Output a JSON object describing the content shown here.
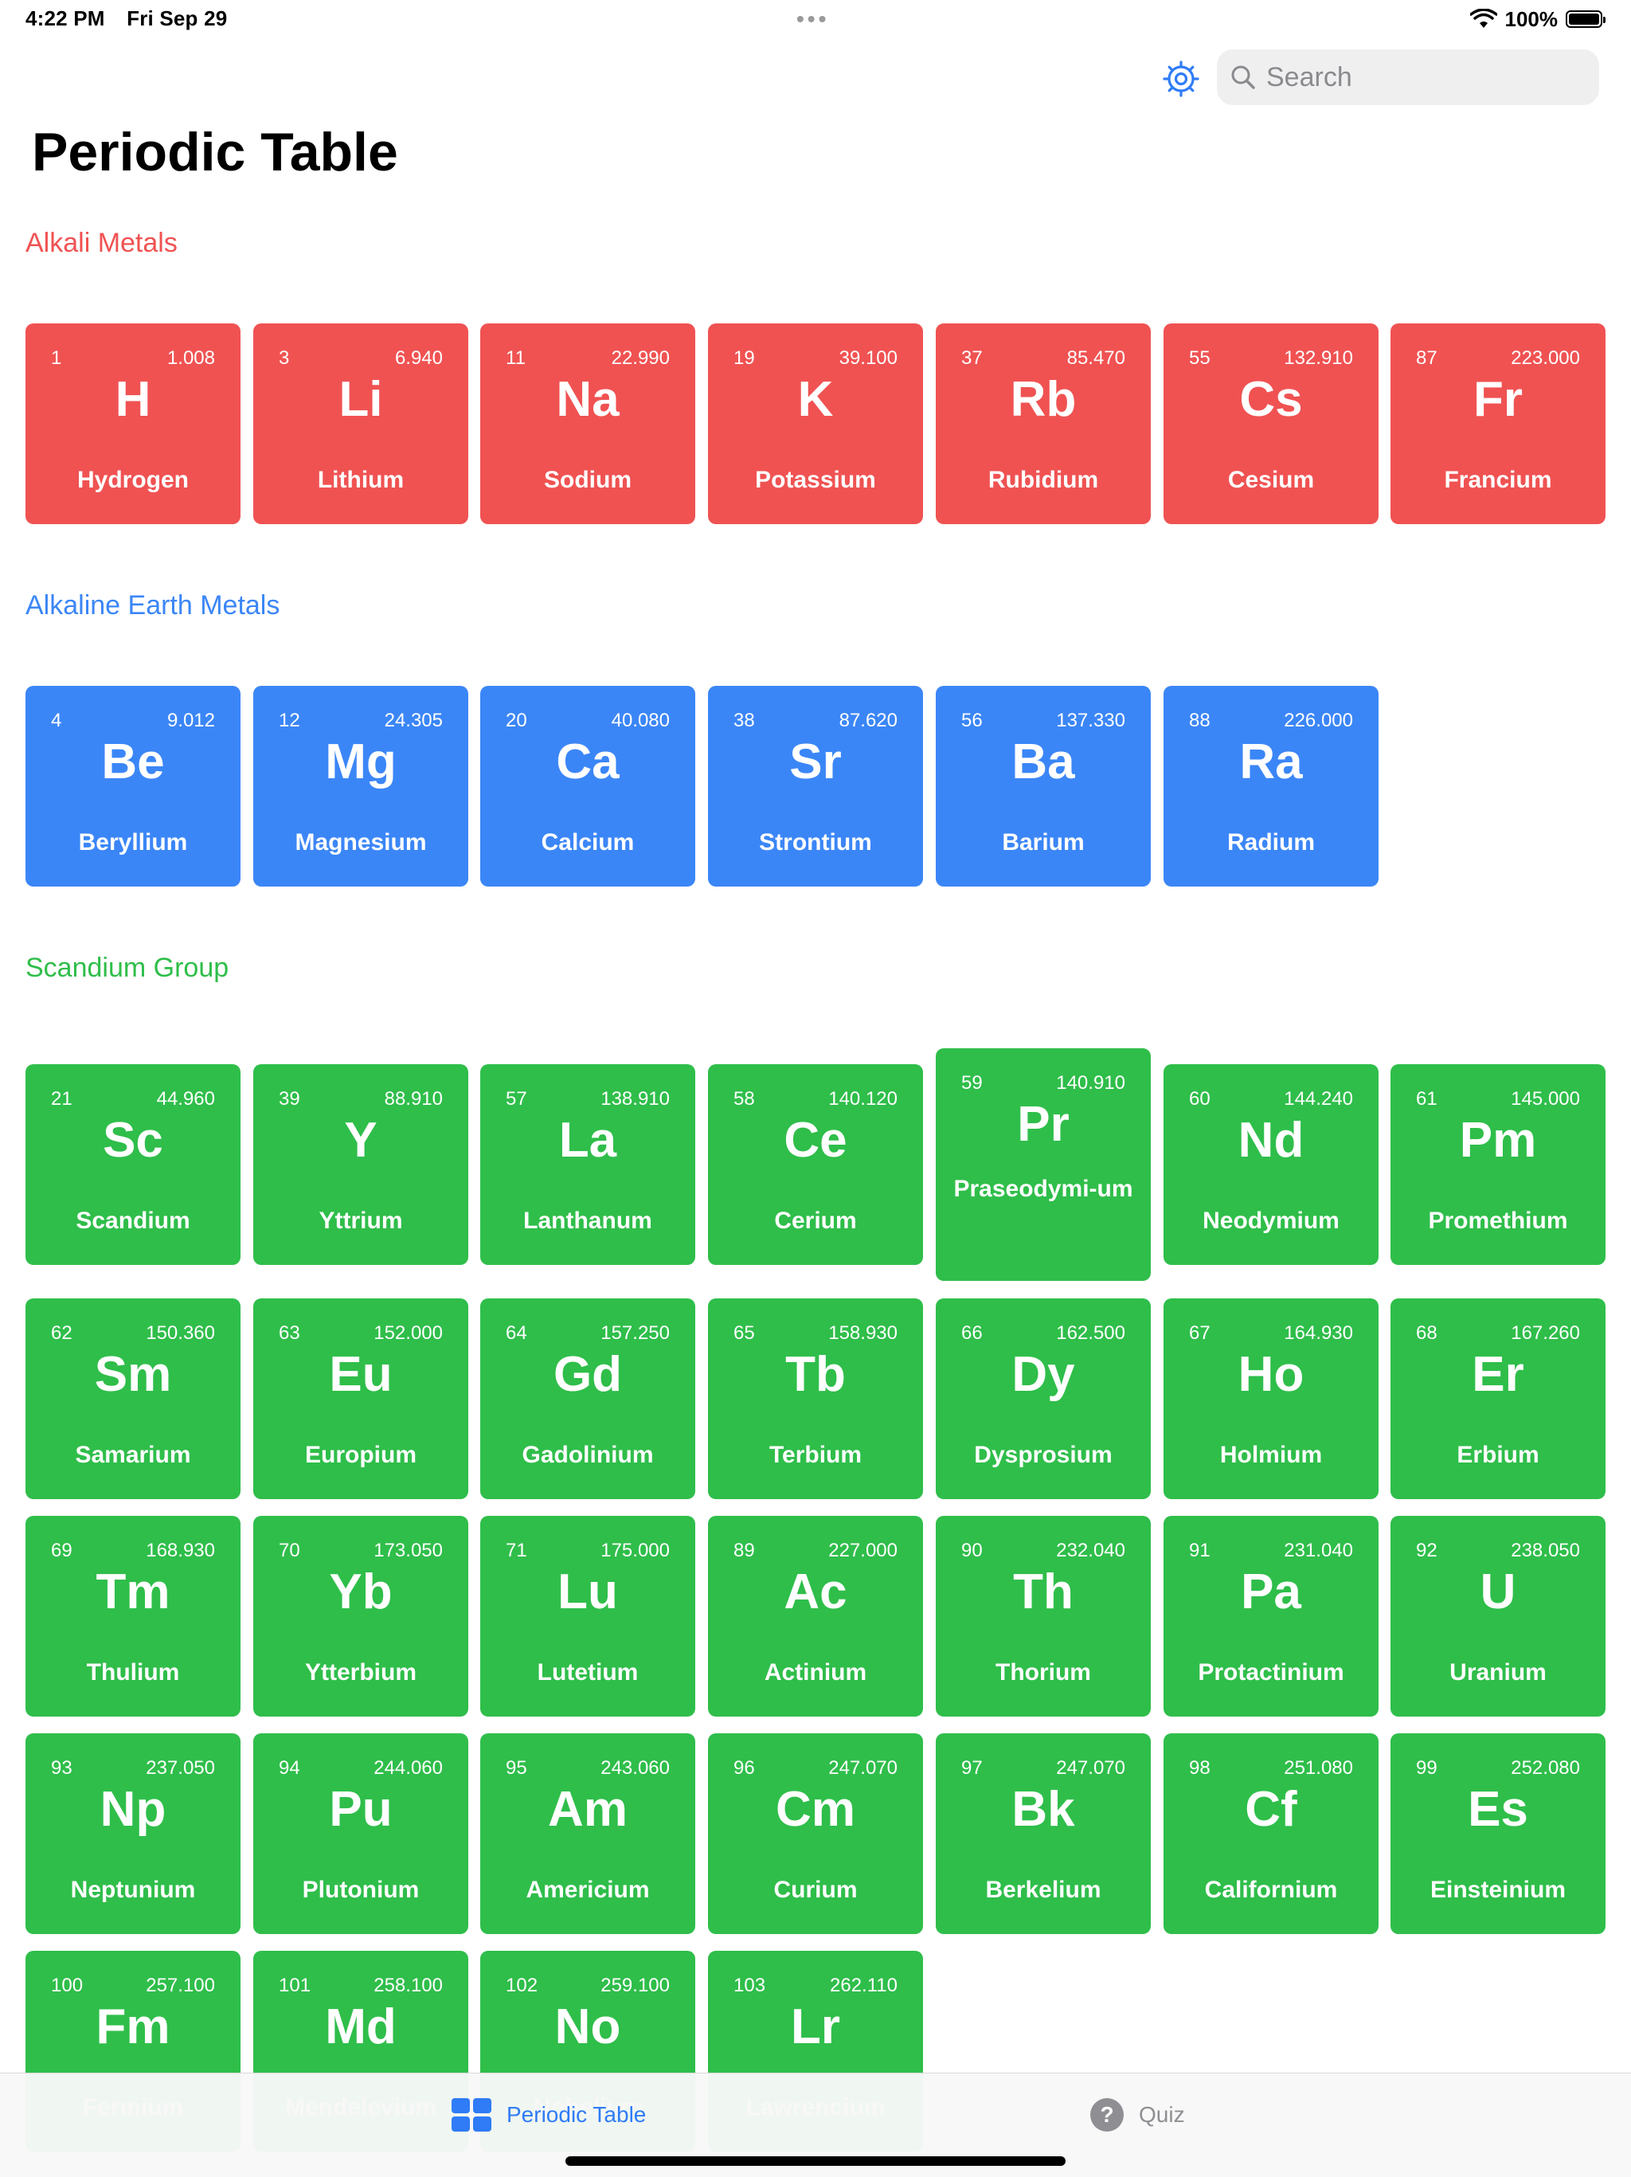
{
  "status_bar": {
    "time": "4:22 PM",
    "date": "Fri Sep 29",
    "dots": "•••",
    "battery": "100%"
  },
  "search": {
    "placeholder": "Search"
  },
  "page_title": "Periodic Table",
  "colors": {
    "alkali": "#f05252",
    "alkaline": "#3b86f7",
    "scandium": "#2fbe4a",
    "accent": "#2f7cf6"
  },
  "sections": {
    "alkali": {
      "title": "Alkali Metals",
      "elements": [
        {
          "number": "1",
          "mass": "1.008",
          "symbol": "H",
          "name": "Hydrogen"
        },
        {
          "number": "3",
          "mass": "6.940",
          "symbol": "Li",
          "name": "Lithium"
        },
        {
          "number": "11",
          "mass": "22.990",
          "symbol": "Na",
          "name": "Sodium"
        },
        {
          "number": "19",
          "mass": "39.100",
          "symbol": "K",
          "name": "Potassium"
        },
        {
          "number": "37",
          "mass": "85.470",
          "symbol": "Rb",
          "name": "Rubidium"
        },
        {
          "number": "55",
          "mass": "132.910",
          "symbol": "Cs",
          "name": "Cesium"
        },
        {
          "number": "87",
          "mass": "223.000",
          "symbol": "Fr",
          "name": "Francium"
        }
      ]
    },
    "alkaline": {
      "title": "Alkaline Earth Metals",
      "elements": [
        {
          "number": "4",
          "mass": "9.012",
          "symbol": "Be",
          "name": "Beryllium"
        },
        {
          "number": "12",
          "mass": "24.305",
          "symbol": "Mg",
          "name": "Magnesium"
        },
        {
          "number": "20",
          "mass": "40.080",
          "symbol": "Ca",
          "name": "Calcium"
        },
        {
          "number": "38",
          "mass": "87.620",
          "symbol": "Sr",
          "name": "Strontium"
        },
        {
          "number": "56",
          "mass": "137.330",
          "symbol": "Ba",
          "name": "Barium"
        },
        {
          "number": "88",
          "mass": "226.000",
          "symbol": "Ra",
          "name": "Radium"
        }
      ]
    },
    "scandium": {
      "title": "Scandium Group",
      "elements": [
        {
          "number": "21",
          "mass": "44.960",
          "symbol": "Sc",
          "name": "Scandium"
        },
        {
          "number": "39",
          "mass": "88.910",
          "symbol": "Y",
          "name": "Yttrium"
        },
        {
          "number": "57",
          "mass": "138.910",
          "symbol": "La",
          "name": "Lanthanum"
        },
        {
          "number": "58",
          "mass": "140.120",
          "symbol": "Ce",
          "name": "Cerium"
        },
        {
          "number": "59",
          "mass": "140.910",
          "symbol": "Pr",
          "name": "Praseodymi-um"
        },
        {
          "number": "60",
          "mass": "144.240",
          "symbol": "Nd",
          "name": "Neodymium"
        },
        {
          "number": "61",
          "mass": "145.000",
          "symbol": "Pm",
          "name": "Promethium"
        },
        {
          "number": "62",
          "mass": "150.360",
          "symbol": "Sm",
          "name": "Samarium"
        },
        {
          "number": "63",
          "mass": "152.000",
          "symbol": "Eu",
          "name": "Europium"
        },
        {
          "number": "64",
          "mass": "157.250",
          "symbol": "Gd",
          "name": "Gadolinium"
        },
        {
          "number": "65",
          "mass": "158.930",
          "symbol": "Tb",
          "name": "Terbium"
        },
        {
          "number": "66",
          "mass": "162.500",
          "symbol": "Dy",
          "name": "Dysprosium"
        },
        {
          "number": "67",
          "mass": "164.930",
          "symbol": "Ho",
          "name": "Holmium"
        },
        {
          "number": "68",
          "mass": "167.260",
          "symbol": "Er",
          "name": "Erbium"
        },
        {
          "number": "69",
          "mass": "168.930",
          "symbol": "Tm",
          "name": "Thulium"
        },
        {
          "number": "70",
          "mass": "173.050",
          "symbol": "Yb",
          "name": "Ytterbium"
        },
        {
          "number": "71",
          "mass": "175.000",
          "symbol": "Lu",
          "name": "Lutetium"
        },
        {
          "number": "89",
          "mass": "227.000",
          "symbol": "Ac",
          "name": "Actinium"
        },
        {
          "number": "90",
          "mass": "232.040",
          "symbol": "Th",
          "name": "Thorium"
        },
        {
          "number": "91",
          "mass": "231.040",
          "symbol": "Pa",
          "name": "Protactinium"
        },
        {
          "number": "92",
          "mass": "238.050",
          "symbol": "U",
          "name": "Uranium"
        },
        {
          "number": "93",
          "mass": "237.050",
          "symbol": "Np",
          "name": "Neptunium"
        },
        {
          "number": "94",
          "mass": "244.060",
          "symbol": "Pu",
          "name": "Plutonium"
        },
        {
          "number": "95",
          "mass": "243.060",
          "symbol": "Am",
          "name": "Americium"
        },
        {
          "number": "96",
          "mass": "247.070",
          "symbol": "Cm",
          "name": "Curium"
        },
        {
          "number": "97",
          "mass": "247.070",
          "symbol": "Bk",
          "name": "Berkelium"
        },
        {
          "number": "98",
          "mass": "251.080",
          "symbol": "Cf",
          "name": "Californium"
        },
        {
          "number": "99",
          "mass": "252.080",
          "symbol": "Es",
          "name": "Einsteinium"
        },
        {
          "number": "100",
          "mass": "257.100",
          "symbol": "Fm",
          "name": "Fermium"
        },
        {
          "number": "101",
          "mass": "258.100",
          "symbol": "Md",
          "name": "Mendelevium"
        },
        {
          "number": "102",
          "mass": "259.100",
          "symbol": "No",
          "name": "Nobelium"
        },
        {
          "number": "103",
          "mass": "262.110",
          "symbol": "Lr",
          "name": "Lawrencium"
        }
      ]
    }
  },
  "tabbar": {
    "tabs": [
      {
        "label": "Periodic Table",
        "icon": "grid-icon",
        "selected": true
      },
      {
        "label": "Quiz",
        "icon": "question-circle-icon",
        "selected": false
      }
    ]
  }
}
